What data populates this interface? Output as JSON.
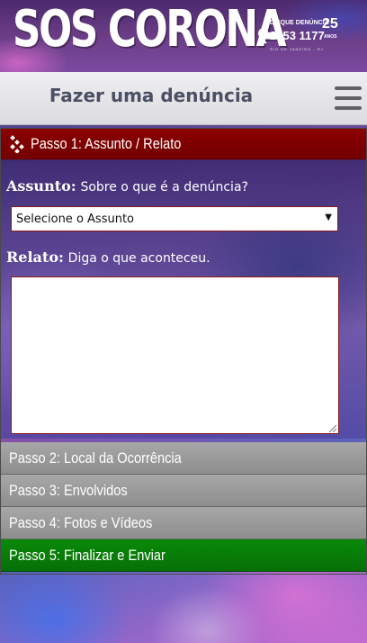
{
  "header": {
    "logo_text": "SOS CORONA",
    "disque_label": "DISQUE DENÚNCIA",
    "disque_phone": "2253 1177",
    "disque_city": "RIO DE JANEIRO - RJ",
    "anos_number": "25",
    "anos_label": "ANOS"
  },
  "nav": {
    "title": "Fazer uma denúncia",
    "menu_icon": "hamburger-menu-icon"
  },
  "form": {
    "step1_label": "Passo 1: Assunto / Relato",
    "assunto_label": "Assunto:",
    "assunto_hint": "Sobre o que é a denúncia?",
    "assunto_select_value": "Selecione o Assunto",
    "relato_label": "Relato:",
    "relato_hint": "Diga o que aconteceu.",
    "relato_value": ""
  },
  "steps": [
    {
      "label": "Passo 2: Local da Ocorrência"
    },
    {
      "label": "Passo 3: Envolvidos"
    },
    {
      "label": "Passo 4: Fotos e Vídeos"
    },
    {
      "label": "Passo 5: Finalizar e Enviar"
    }
  ],
  "colors": {
    "active_step": "#8b0000",
    "inactive_step": "#9a9a9a",
    "final_step": "#0a8a0a",
    "nav_title": "#4b4f63"
  }
}
